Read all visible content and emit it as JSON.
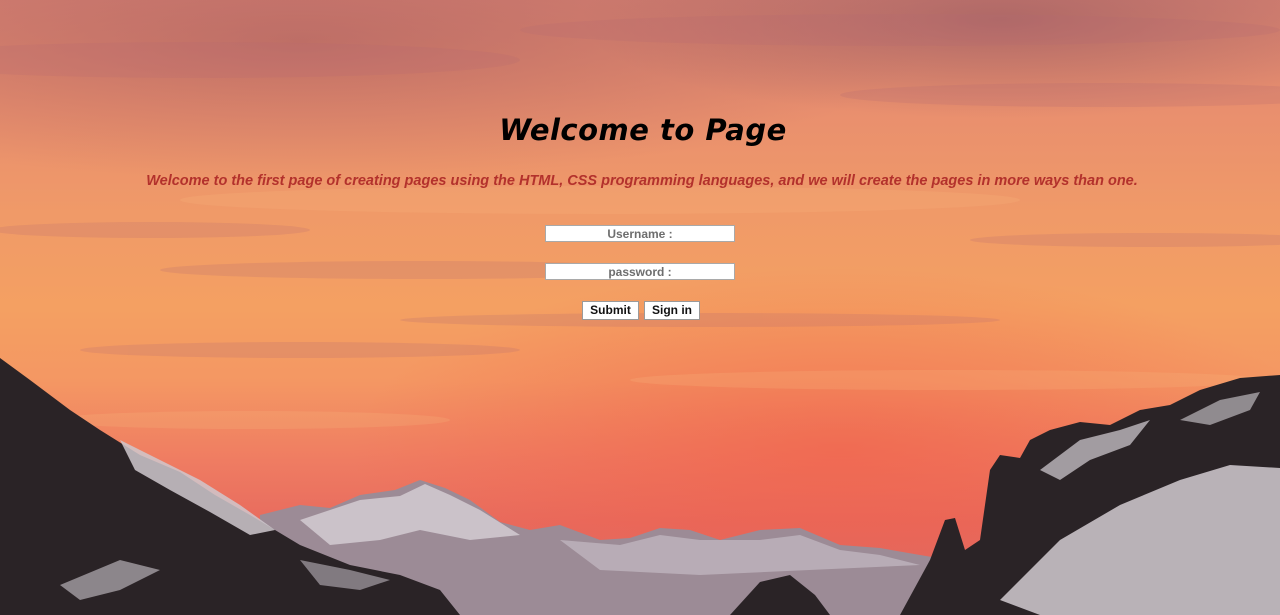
{
  "page": {
    "title": "Welcome to Page",
    "subtitle": "Welcome to the first page of creating pages using the HTML, CSS programming languages, and we will create the pages in more ways than one."
  },
  "form": {
    "username_placeholder": "Username :",
    "password_placeholder": "password :",
    "username_value": "",
    "password_value": "",
    "submit_label": "Submit",
    "signin_label": "Sign in"
  },
  "colors": {
    "title": "#000000",
    "subtitle": "#b3312c",
    "sky_top": "#d98372",
    "sky_mid": "#f4a062",
    "sky_low": "#e86b5e",
    "mountain_dark": "#2a2326",
    "mountain_snow": "#c9c2c8"
  },
  "background": {
    "scene": "sunset-sky-over-snowy-mountains"
  }
}
